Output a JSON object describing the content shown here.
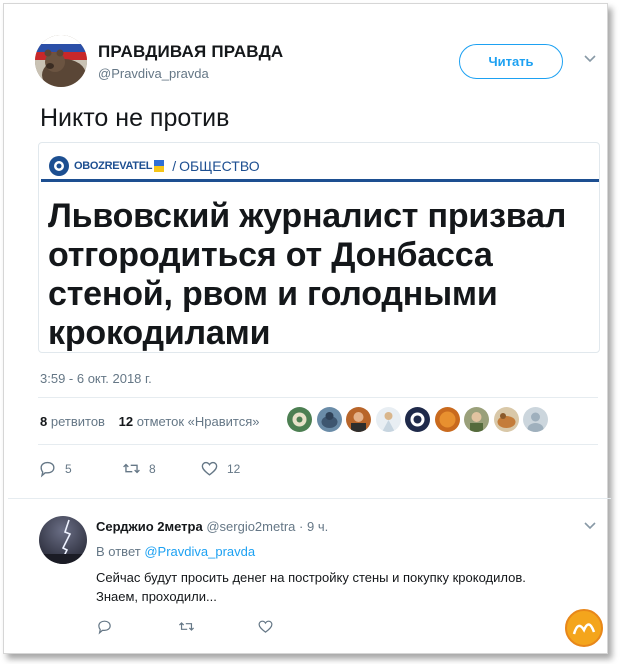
{
  "tweet": {
    "author_name": "ПРАВДИВАЯ ПРАВДА",
    "author_handle": "@Pravdiva_pravda",
    "follow_label": "Читать",
    "text": "Никто не против",
    "timestamp": "3:59 - 6 окт. 2018 г.",
    "retweets_count": "8",
    "retweets_label": "ретвитов",
    "likes_count": "12",
    "likes_label": "отметок «Нравится»",
    "actions": {
      "reply_count": "5",
      "retweet_count": "8",
      "like_count": "12"
    }
  },
  "card": {
    "brand": "OBOZREVATEL",
    "separator": "/",
    "section": "ОБЩЕСТВО",
    "headline": "Львовский журналист призвал отгородиться от Донбасса стеной, рвом и голодными крокодилами"
  },
  "reply": {
    "author_name": "Серджио 2метра",
    "author_handle": "@sergio2metra",
    "time": "· 9 ч.",
    "reply_to_label": "В ответ",
    "reply_to_handle": "@Pravdiva_pravda",
    "text": "Сейчас будут просить денег на постройку стены и покупку крокодилов. Знаем, проходили..."
  },
  "colors": {
    "accent": "#1da1f2",
    "brand_blue": "#1d4f91",
    "muted": "#657786",
    "text": "#14171a"
  },
  "icons": [
    "caret-down-icon",
    "reply-icon",
    "retweet-icon",
    "like-icon",
    "obozrevatel-logo-icon"
  ]
}
